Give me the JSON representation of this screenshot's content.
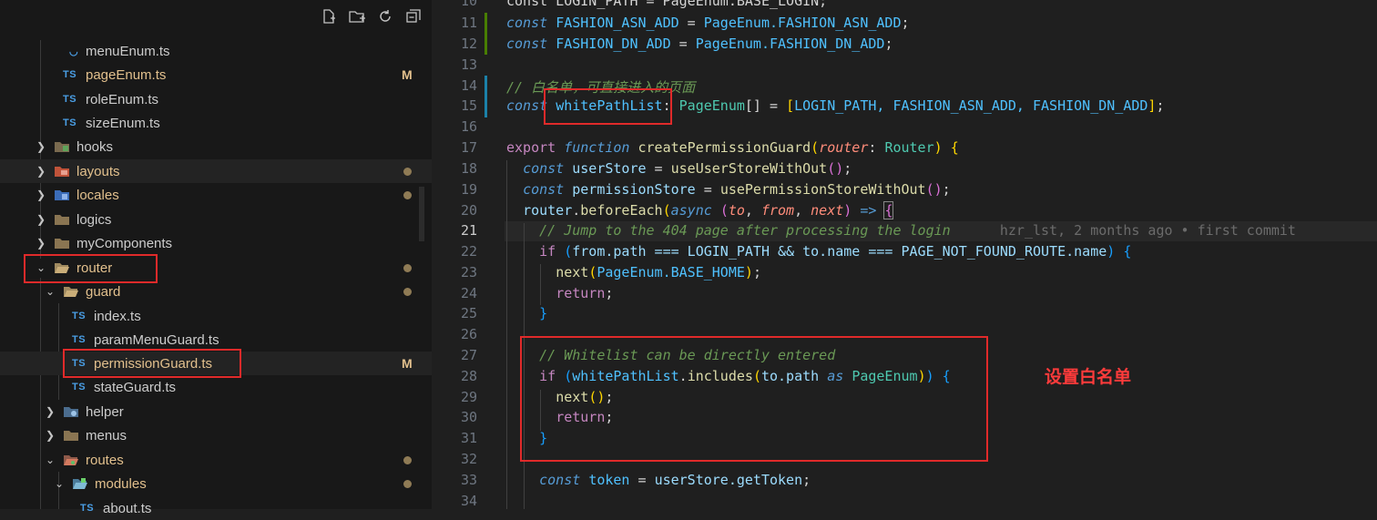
{
  "sidebar": {
    "toolbar": [
      {
        "icon": "new-file-icon"
      },
      {
        "icon": "new-folder-icon"
      },
      {
        "icon": "refresh-icon"
      },
      {
        "icon": "collapse-all-icon"
      }
    ],
    "tree": [
      {
        "label": "menuEnum.ts",
        "kind": "ts",
        "depth": 2,
        "status": ""
      },
      {
        "label": "pageEnum.ts",
        "kind": "ts",
        "depth": 2,
        "status": "M"
      },
      {
        "label": "roleEnum.ts",
        "kind": "ts",
        "depth": 2,
        "status": ""
      },
      {
        "label": "sizeEnum.ts",
        "kind": "ts",
        "depth": 2,
        "status": ""
      },
      {
        "label": "hooks",
        "kind": "folder",
        "depth": 1,
        "status": ""
      },
      {
        "label": "layouts",
        "kind": "folder",
        "depth": 1,
        "status": "dot"
      },
      {
        "label": "locales",
        "kind": "folder",
        "depth": 1,
        "status": "dot"
      },
      {
        "label": "logics",
        "kind": "folder",
        "depth": 1,
        "status": ""
      },
      {
        "label": "myComponents",
        "kind": "folder",
        "depth": 1,
        "status": ""
      },
      {
        "label": "router",
        "kind": "folder-open",
        "depth": 1,
        "status": "dot"
      },
      {
        "label": "guard",
        "kind": "folder-open",
        "depth": 2,
        "status": "dot"
      },
      {
        "label": "index.ts",
        "kind": "ts",
        "depth": 3,
        "status": ""
      },
      {
        "label": "paramMenuGuard.ts",
        "kind": "ts",
        "depth": 3,
        "status": ""
      },
      {
        "label": "permissionGuard.ts",
        "kind": "ts",
        "depth": 3,
        "status": "M"
      },
      {
        "label": "stateGuard.ts",
        "kind": "ts",
        "depth": 3,
        "status": ""
      },
      {
        "label": "helper",
        "kind": "folder",
        "depth": 2,
        "status": ""
      },
      {
        "label": "menus",
        "kind": "folder",
        "depth": 2,
        "status": ""
      },
      {
        "label": "routes",
        "kind": "folder-open",
        "depth": 2,
        "status": "dot"
      },
      {
        "label": "modules",
        "kind": "folder-open",
        "depth": 3,
        "status": "dot"
      },
      {
        "label": "about.ts",
        "kind": "ts",
        "depth": 4,
        "status": ""
      }
    ]
  },
  "editor": {
    "line_numbers": [
      "10",
      "11",
      "12",
      "13",
      "14",
      "15",
      "16",
      "17",
      "18",
      "19",
      "20",
      "21",
      "22",
      "23",
      "24",
      "25",
      "26",
      "27",
      "28",
      "29",
      "30",
      "31",
      "32",
      "33",
      "34"
    ],
    "current_line": "21",
    "blame": "hzr_lst, 2 months ago • first commit",
    "annotation": "设置白名单",
    "lines": {
      "l10": "const LOGIN_PATH = PageEnum.BASE_LOGIN;",
      "l11_k": "const",
      "l11_v": "FASHION_ASN_ADD",
      "l11_eq": " = ",
      "l11_r": "PageEnum.FASHION_ASN_ADD",
      "l11_end": ";",
      "l12_k": "const",
      "l12_v": "FASHION_DN_ADD",
      "l12_eq": " = ",
      "l12_r": "PageEnum.FASHION_DN_ADD",
      "l12_end": ";",
      "l14": "// 白名单，可直接进入的页面",
      "l15_k": "const",
      "l15_v": "whitePathList",
      "l15_col": ": ",
      "l15_t": "PageEnum",
      "l15_arr": "[]",
      "l15_eq": " = ",
      "l15_b1": "[",
      "l15_list": "LOGIN_PATH, FASHION_ASN_ADD, FASHION_DN_ADD",
      "l15_b2": "]",
      "l15_end": ";",
      "l17_export": "export",
      "l17_function": "function",
      "l17_name": "createPermissionGuard",
      "l17_p1": "(",
      "l17_param": "router",
      "l17_col": ": ",
      "l17_type": "Router",
      "l17_p2": ")",
      "l17_brace": "{",
      "l18_k": "const",
      "l18_v": "userStore",
      "l18_eq": " = ",
      "l18_fn": "useUserStoreWithOut",
      "l18_par": "()",
      "l18_end": ";",
      "l19_k": "const",
      "l19_v": "permissionStore",
      "l19_eq": " = ",
      "l19_fn": "usePermissionStoreWithOut",
      "l19_par": "()",
      "l19_end": ";",
      "l20_obj": "router",
      "l20_dot": ".",
      "l20_fn": "beforeEach",
      "l20_p1": "(",
      "l20_async": "async",
      "l20_p2": "(",
      "l20_to": "to",
      "l20_comma1": ", ",
      "l20_from": "from",
      "l20_comma2": ", ",
      "l20_next": "next",
      "l20_p3": ")",
      "l20_arrow": " => ",
      "l20_brace": "{",
      "l21": "// Jump to the 404 page after processing the login",
      "l22_if": "if",
      "l22_p1": "(",
      "l22_a": "from.path === LOGIN_PATH && to.name === PAGE_NOT_FOUND_ROUTE.name",
      "l22_p2": ")",
      "l22_brace": "{",
      "l23_fn": "next",
      "l23_p1": "(",
      "l23_arg": "PageEnum.BASE_HOME",
      "l23_p2": ")",
      "l23_end": ";",
      "l24": "return",
      "l24_end": ";",
      "l25": "}",
      "l27": "// Whitelist can be directly entered",
      "l28_if": "if",
      "l28_p1": "(",
      "l28_v": "whitePathList",
      "l28_dot": ".",
      "l28_fn": "includes",
      "l28_p2": "(",
      "l28_arg": "to.path",
      "l28_as": " as ",
      "l28_t": "PageEnum",
      "l28_p3": ")",
      "l28_p4": ")",
      "l28_brace": "{",
      "l29_fn": "next",
      "l29_par": "()",
      "l29_end": ";",
      "l30": "return",
      "l30_end": ";",
      "l31": "}",
      "l33_k": "const",
      "l33_v": "token",
      "l33_eq": " = ",
      "l33_r": "userStore.getToken",
      "l33_end": ";"
    }
  }
}
